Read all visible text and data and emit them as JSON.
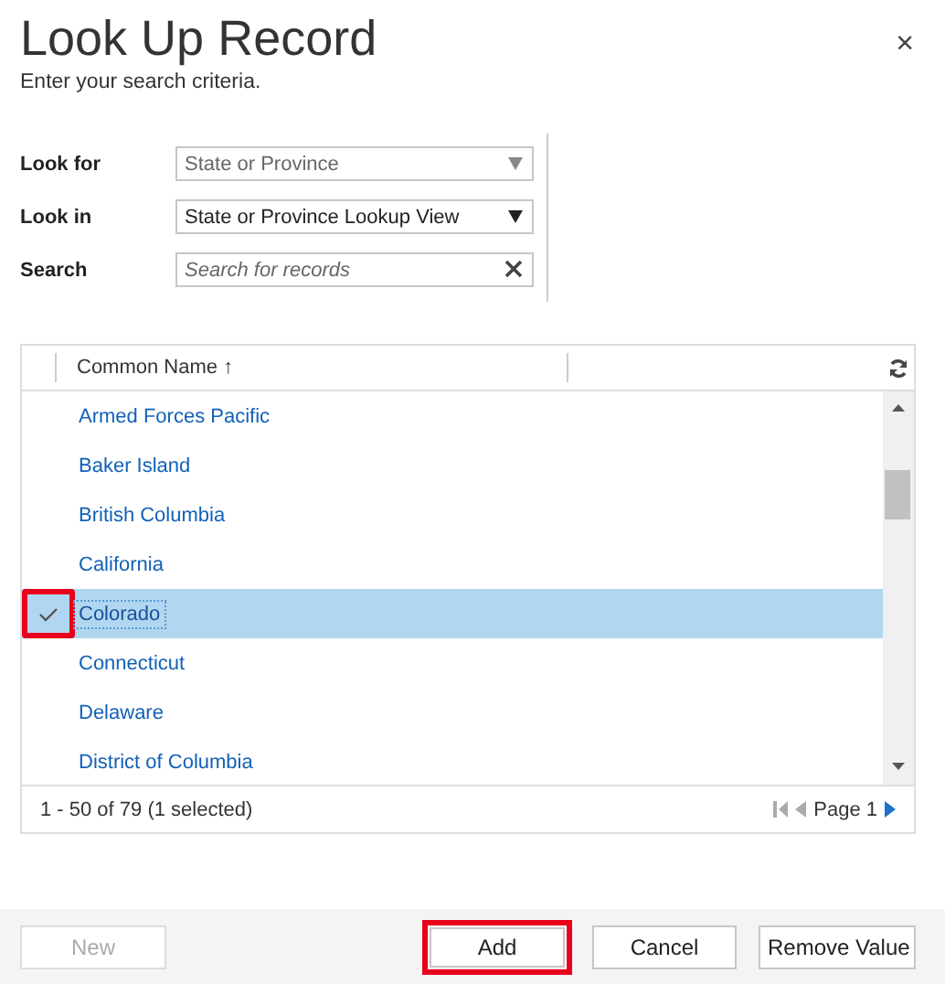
{
  "dialog": {
    "title": "Look Up Record",
    "subtitle": "Enter your search criteria.",
    "close": "×"
  },
  "form": [
    {
      "kind": "select",
      "label": "Look for",
      "value": "State or Province",
      "disabled": true
    },
    {
      "kind": "select",
      "label": "Look in",
      "value": "State or Province Lookup View",
      "disabled": false
    },
    {
      "kind": "search",
      "label": "Search",
      "placeholder": "Search for records"
    }
  ],
  "grid": {
    "column": "Common Name",
    "sort_arrow": "↑",
    "rows": [
      {
        "name": "Armed Forces Pacific",
        "selected": false,
        "highlighted": false
      },
      {
        "name": "Baker Island",
        "selected": false,
        "highlighted": false
      },
      {
        "name": "British Columbia",
        "selected": false,
        "highlighted": false
      },
      {
        "name": "California",
        "selected": false,
        "highlighted": false
      },
      {
        "name": "Colorado",
        "selected": true,
        "highlighted": true
      },
      {
        "name": "Connecticut",
        "selected": false,
        "highlighted": false
      },
      {
        "name": "Delaware",
        "selected": false,
        "highlighted": false
      },
      {
        "name": "District of Columbia",
        "selected": false,
        "highlighted": false
      }
    ],
    "status": "1 - 50 of 79 (1 selected)",
    "page": "Page 1"
  },
  "buttons": [
    {
      "label": "New",
      "disabled": true,
      "highlighted": false
    },
    {
      "label": "Add",
      "disabled": false,
      "highlighted": true
    },
    {
      "label": "Cancel",
      "disabled": false,
      "highlighted": false
    },
    {
      "label": "Remove Value",
      "disabled": false,
      "highlighted": false
    }
  ]
}
